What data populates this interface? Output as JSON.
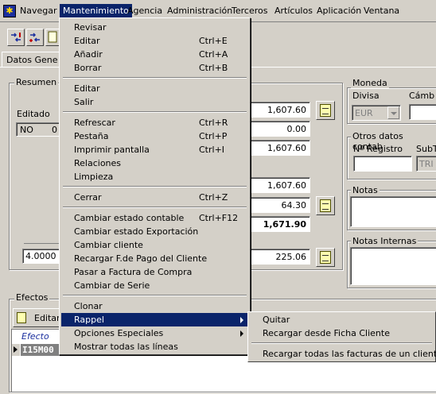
{
  "menubar": {
    "items": [
      "Navegar",
      "Mantenimiento",
      "Agencia",
      "Administración",
      "Terceros",
      "Artículos",
      "Aplicación",
      "Ventana"
    ]
  },
  "tab": {
    "label": "Datos Gene"
  },
  "resumen": {
    "title": "Resumen",
    "editado_label": "Editado",
    "editado_value": "NO",
    "editado_value2": "0",
    "rate_value": "4.0000",
    "values": [
      "1,607.60",
      "0.00",
      "1,607.60",
      "1,607.60",
      "64.30",
      "1,671.90",
      "225.06"
    ]
  },
  "moneda": {
    "title": "Moneda",
    "divisa_label": "Divisa",
    "cambio_label": "Cámb",
    "divisa_value": "EUR"
  },
  "otros": {
    "title": "Otros datos contab",
    "registro_label": "Nº Registro",
    "subt_label": "SubT",
    "subt_value": "TRI"
  },
  "notas": {
    "title": "Notas"
  },
  "notas_internas": {
    "title": "Notas Internas"
  },
  "efectos": {
    "title": "Efectos",
    "edit_button": "Editar",
    "column": "Efecto",
    "row_value": "I15M00"
  },
  "menu": {
    "groups": [
      [
        {
          "label": "Revisar",
          "shortcut": ""
        },
        {
          "label": "Editar",
          "shortcut": "Ctrl+E"
        },
        {
          "label": "Añadir",
          "shortcut": "Ctrl+A"
        },
        {
          "label": "Borrar",
          "shortcut": "Ctrl+B"
        }
      ],
      [
        {
          "label": "Editar",
          "shortcut": ""
        },
        {
          "label": "Salir",
          "shortcut": ""
        }
      ],
      [
        {
          "label": "Refrescar",
          "shortcut": "Ctrl+R"
        },
        {
          "label": "Pestaña",
          "shortcut": "Ctrl+P"
        },
        {
          "label": "Imprimir pantalla",
          "shortcut": "Ctrl+I"
        },
        {
          "label": "Relaciones",
          "shortcut": ""
        },
        {
          "label": "Limpieza",
          "shortcut": ""
        }
      ],
      [
        {
          "label": "Cerrar",
          "shortcut": "Ctrl+Z"
        }
      ],
      [
        {
          "label": "Cambiar estado contable",
          "shortcut": "Ctrl+F12"
        },
        {
          "label": "Cambiar estado Exportación",
          "shortcut": ""
        },
        {
          "label": "Cambiar cliente",
          "shortcut": ""
        },
        {
          "label": "Recargar F.de Pago del Cliente",
          "shortcut": ""
        },
        {
          "label": "Pasar a Factura de Compra",
          "shortcut": ""
        },
        {
          "label": "Cambiar de Serie",
          "shortcut": ""
        }
      ],
      [
        {
          "label": "Clonar",
          "shortcut": ""
        },
        {
          "label": "Rappel",
          "shortcut": ""
        },
        {
          "label": "Opciones Especiales",
          "shortcut": ""
        },
        {
          "label": "Mostrar todas las líneas",
          "shortcut": ""
        }
      ]
    ]
  },
  "submenu": {
    "items": [
      "Quitar",
      "Recargar desde Ficha Cliente",
      "Recargar todas las facturas de un cliente"
    ]
  },
  "colors": {
    "highlight": "#0a246a",
    "face": "#d4d0c8"
  }
}
